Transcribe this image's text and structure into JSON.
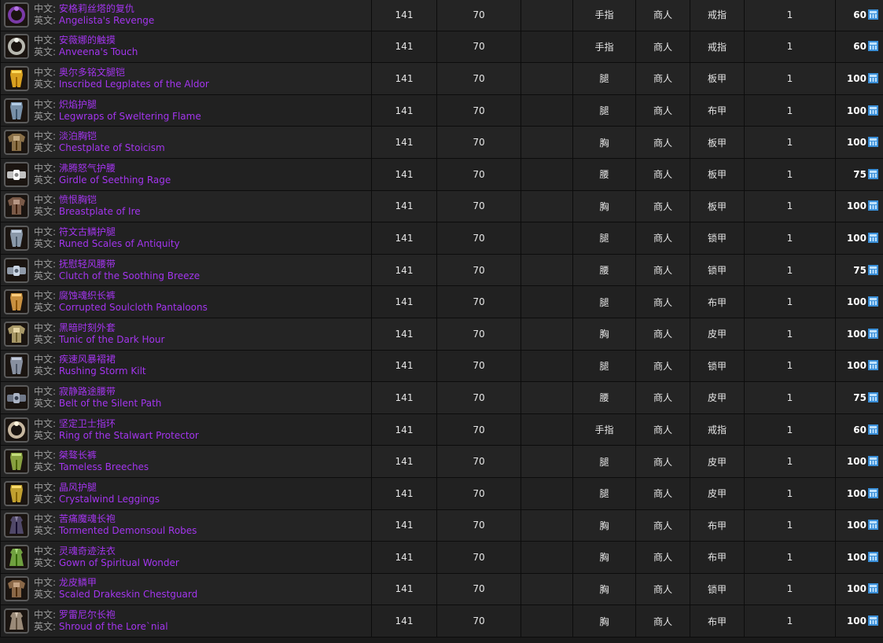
{
  "labels": {
    "zh_prefix": "中文:",
    "en_prefix": "英文:"
  },
  "currency": {
    "icon": "badge-of-justice-icon",
    "color": "#3a8fd8"
  },
  "rows": [
    {
      "zh": "安格莉丝塔的复仇",
      "en": "Angelista's Revenge",
      "col_a": "141",
      "col_b": "70",
      "slot": "手指",
      "source": "商人",
      "type": "戒指",
      "qty": "1",
      "cost": "60",
      "icon": "ring-icon",
      "icon_color": "#7a3aa8"
    },
    {
      "zh": "安薇娜的触摸",
      "en": "Anveena's Touch",
      "col_a": "141",
      "col_b": "70",
      "slot": "手指",
      "source": "商人",
      "type": "戒指",
      "qty": "1",
      "cost": "60",
      "icon": "ring-icon",
      "icon_color": "#b8b8b0"
    },
    {
      "zh": "奥尔多铭文腿铠",
      "en": "Inscribed Legplates of the Aldor",
      "col_a": "141",
      "col_b": "70",
      "slot": "腿",
      "source": "商人",
      "type": "板甲",
      "qty": "1",
      "cost": "100",
      "icon": "plate-legs-icon",
      "icon_color": "#d8a020"
    },
    {
      "zh": "炽焰护腿",
      "en": "Legwraps of Sweltering Flame",
      "col_a": "141",
      "col_b": "70",
      "slot": "腿",
      "source": "商人",
      "type": "布甲",
      "qty": "1",
      "cost": "100",
      "icon": "cloth-legs-icon",
      "icon_color": "#7890a8"
    },
    {
      "zh": "淡泊胸铠",
      "en": "Chestplate of Stoicism",
      "col_a": "141",
      "col_b": "70",
      "slot": "胸",
      "source": "商人",
      "type": "板甲",
      "qty": "1",
      "cost": "100",
      "icon": "plate-chest-icon",
      "icon_color": "#8a7048"
    },
    {
      "zh": "沸腾怒气护腰",
      "en": "Girdle of Seething Rage",
      "col_a": "141",
      "col_b": "70",
      "slot": "腰",
      "source": "商人",
      "type": "板甲",
      "qty": "1",
      "cost": "75",
      "icon": "skull-belt-icon",
      "icon_color": "#c0c0c0"
    },
    {
      "zh": "愤恨胸铠",
      "en": "Breastplate of Ire",
      "col_a": "141",
      "col_b": "70",
      "slot": "胸",
      "source": "商人",
      "type": "板甲",
      "qty": "1",
      "cost": "100",
      "icon": "plate-chest-icon",
      "icon_color": "#7a5a48"
    },
    {
      "zh": "符文古鳞护腿",
      "en": "Runed Scales of Antiquity",
      "col_a": "141",
      "col_b": "70",
      "slot": "腿",
      "source": "商人",
      "type": "锁甲",
      "qty": "1",
      "cost": "100",
      "icon": "mail-legs-icon",
      "icon_color": "#8a98a8"
    },
    {
      "zh": "抚慰轻风腰带",
      "en": "Clutch of the Soothing Breeze",
      "col_a": "141",
      "col_b": "70",
      "slot": "腰",
      "source": "商人",
      "type": "锁甲",
      "qty": "1",
      "cost": "75",
      "icon": "mail-belt-icon",
      "icon_color": "#909aa8"
    },
    {
      "zh": "腐蚀魂织长裤",
      "en": "Corrupted Soulcloth Pantaloons",
      "col_a": "141",
      "col_b": "70",
      "slot": "腿",
      "source": "商人",
      "type": "布甲",
      "qty": "1",
      "cost": "100",
      "icon": "cloth-legs-icon",
      "icon_color": "#c89040"
    },
    {
      "zh": "黑暗时刻外套",
      "en": "Tunic of the Dark Hour",
      "col_a": "141",
      "col_b": "70",
      "slot": "胸",
      "source": "商人",
      "type": "皮甲",
      "qty": "1",
      "cost": "100",
      "icon": "leather-chest-icon",
      "icon_color": "#a89868"
    },
    {
      "zh": "疾速风暴褶裙",
      "en": "Rushing Storm Kilt",
      "col_a": "141",
      "col_b": "70",
      "slot": "腿",
      "source": "商人",
      "type": "锁甲",
      "qty": "1",
      "cost": "100",
      "icon": "mail-legs-icon",
      "icon_color": "#8890a0"
    },
    {
      "zh": "寂静路途腰带",
      "en": "Belt of the Silent Path",
      "col_a": "141",
      "col_b": "70",
      "slot": "腰",
      "source": "商人",
      "type": "皮甲",
      "qty": "1",
      "cost": "75",
      "icon": "leather-belt-icon",
      "icon_color": "#707888"
    },
    {
      "zh": "坚定卫士指环",
      "en": "Ring of the Stalwart Protector",
      "col_a": "141",
      "col_b": "70",
      "slot": "手指",
      "source": "商人",
      "type": "戒指",
      "qty": "1",
      "cost": "60",
      "icon": "ring-icon",
      "icon_color": "#c8b8a0"
    },
    {
      "zh": "桀骜长裤",
      "en": "Tameless Breeches",
      "col_a": "141",
      "col_b": "70",
      "slot": "腿",
      "source": "商人",
      "type": "皮甲",
      "qty": "1",
      "cost": "100",
      "icon": "leather-legs-icon",
      "icon_color": "#88a040"
    },
    {
      "zh": "晶风护腿",
      "en": "Crystalwind Leggings",
      "col_a": "141",
      "col_b": "70",
      "slot": "腿",
      "source": "商人",
      "type": "皮甲",
      "qty": "1",
      "cost": "100",
      "icon": "leather-legs-icon",
      "icon_color": "#c0a030"
    },
    {
      "zh": "苦痛魔魂长袍",
      "en": "Tormented Demonsoul Robes",
      "col_a": "141",
      "col_b": "70",
      "slot": "胸",
      "source": "商人",
      "type": "布甲",
      "qty": "1",
      "cost": "100",
      "icon": "robe-icon",
      "icon_color": "#504868"
    },
    {
      "zh": "灵魂奇迹法衣",
      "en": "Gown of Spiritual Wonder",
      "col_a": "141",
      "col_b": "70",
      "slot": "胸",
      "source": "商人",
      "type": "布甲",
      "qty": "1",
      "cost": "100",
      "icon": "robe-icon",
      "icon_color": "#70a040"
    },
    {
      "zh": "龙皮鳞甲",
      "en": "Scaled Drakeskin Chestguard",
      "col_a": "141",
      "col_b": "70",
      "slot": "胸",
      "source": "商人",
      "type": "锁甲",
      "qty": "1",
      "cost": "100",
      "icon": "mail-chest-icon",
      "icon_color": "#8a6848"
    },
    {
      "zh": "罗雷尼尔长袍",
      "en": "Shroud of the Lore`nial",
      "col_a": "141",
      "col_b": "70",
      "slot": "胸",
      "source": "商人",
      "type": "布甲",
      "qty": "1",
      "cost": "100",
      "icon": "robe-icon",
      "icon_color": "#9a8a78"
    }
  ]
}
